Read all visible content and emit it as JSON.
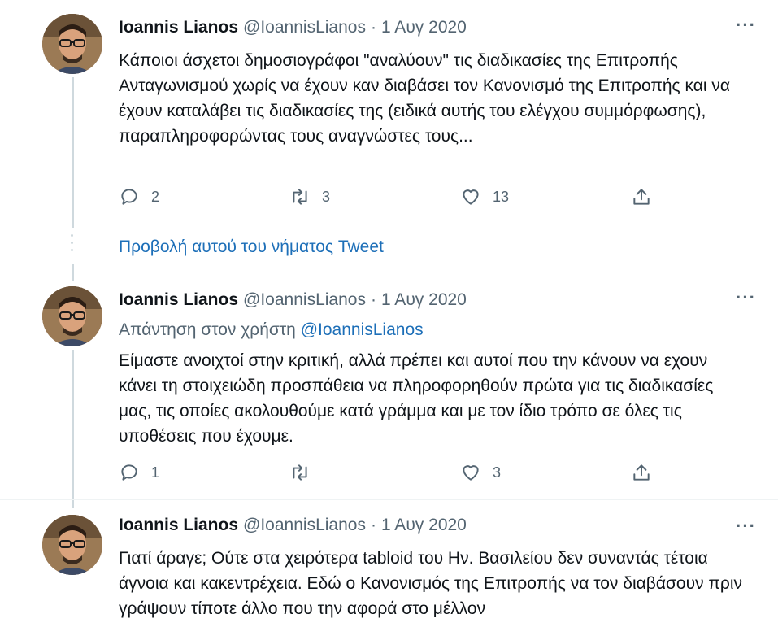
{
  "tweets": [
    {
      "name": "Ioannis Lianos",
      "handle": "@IoannisLianos",
      "dot": "·",
      "date": "1 Αυγ 2020",
      "more": "···",
      "text": "Κάποιοι άσχετοι δημοσιογράφοι \"αναλύουν\" τις διαδικασίες της Επιτροπής Ανταγωνισμού χωρίς να έχουν καν διαβάσει τον Κανονισμό της Επιτροπής και να έχουν καταλάβει τις διαδικασίες της (ειδικά αυτής του ελέγχου συμμόρφωσης), παραπληροφορώντας τους αναγνώστες τους...",
      "replies": "2",
      "retweets": "3",
      "likes": "13"
    },
    {
      "name": "Ioannis Lianos",
      "handle": "@IoannisLianos",
      "dot": "·",
      "date": "1 Αυγ 2020",
      "more": "···",
      "reply_prefix": "Απάντηση στον χρήστη",
      "reply_mention": "@IoannisLianos",
      "text": "Είμαστε ανοιχτοί στην κριτική, αλλά πρέπει και αυτοί που την κάνουν να εχουν κάνει τη στοιχειώδη προσπάθεια να πληροφορηθούν πρώτα για τις διαδικασίες μας, τις οποίες ακολουθούμε κατά γράμμα και με τον ίδιο τρόπο σε όλες τις υποθέσεις που έχουμε.",
      "replies": "1",
      "retweets": "",
      "likes": "3"
    },
    {
      "name": "Ioannis Lianos",
      "handle": "@IoannisLianos",
      "dot": "·",
      "date": "1 Αυγ 2020",
      "more": "···",
      "text": "Γιατί άραγε; Ούτε στα χειρότερα tabloid του Ην. Βασιλείου δεν συναντάς τέτοια άγνοια και κακεντρέχεια. Εδώ ο Κανονισμός της Επιτροπής να τον διαβάσουν πριν γράψουν τίποτε άλλο που την αφορά στο μέλλον"
    }
  ],
  "show_thread": "Προβολή αυτού του νήματος Tweet",
  "colors": {
    "link": "#1d6fb8",
    "muted": "#536471",
    "line": "#cfd9de"
  },
  "icons": [
    "reply-icon",
    "retweet-icon",
    "like-icon",
    "share-icon",
    "more-icon"
  ]
}
